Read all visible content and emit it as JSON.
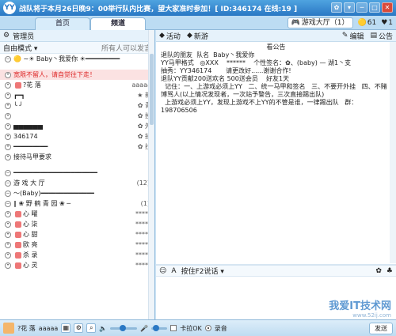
{
  "titlebar": {
    "title": "战队将于本月26日晚9：00举行队内比赛，望大家准时参加！[ ID:346174 在线:19 ]",
    "logo": "YY"
  },
  "tabs": [
    {
      "label": "首页",
      "active": false
    },
    {
      "label": "频道",
      "active": true
    }
  ],
  "status": {
    "hall_label": "游戏大厅（1）",
    "coins": "61",
    "hearts": "1"
  },
  "left": {
    "toolbar_label": "管理员",
    "mode_label": "自由模式",
    "mode_note": "所有人可以发言",
    "tree": [
      {
        "text": "🟡  ∼☀  Baby丶我爱你  ☀━━━━━━━━━",
        "type": "group"
      },
      {
        "text": "",
        "type": "sep"
      },
      {
        "text": "宽限不留人，请自觉往下走！",
        "type": "banner"
      },
      {
        "text": "?花  落",
        "stars": "aaaaa",
        "type": "user"
      },
      {
        "text": "┏━┓",
        "stars": "★  新",
        "type": "sub"
      },
      {
        "text": "╰ ╯",
        "stars": "✿  青",
        "type": "sub"
      },
      {
        "text": "",
        "stars": "✿  投",
        "type": "sub"
      },
      {
        "text": "▅▅▅▅▅▅",
        "stars": "✿  外",
        "type": "sub"
      },
      {
        "text": "346174",
        "stars": "✿  接",
        "type": "sub"
      },
      {
        "text": "━━━━━━━━━",
        "stars": "✿  找",
        "type": "sub"
      },
      {
        "text": "接待马甲要求",
        "type": "sub"
      },
      {
        "text": "",
        "type": "sep"
      },
      {
        "text": "━━━━━━━━━━━━━━━━━━━━━━",
        "type": "group"
      },
      {
        "text": "游 戏 大 厅",
        "count": "(12)",
        "type": "group"
      },
      {
        "text": "～(Baby)━━━━━━━━━━━━━━",
        "type": "group"
      },
      {
        "text": "∥ ❀ 野 鹤 青 园 ❀ ─",
        "count": "(1)",
        "type": "group"
      },
      {
        "text": "心  曜",
        "stars": "*****",
        "type": "user"
      },
      {
        "text": "心  柒",
        "stars": "*****",
        "type": "user"
      },
      {
        "text": "心  甜",
        "stars": "*****",
        "type": "user"
      },
      {
        "text": "欧  亮",
        "stars": "*****",
        "type": "user"
      },
      {
        "text": "杀  录",
        "stars": "*****",
        "type": "user"
      },
      {
        "text": "心  灵",
        "stars": "*****",
        "type": "user"
      }
    ]
  },
  "right": {
    "toolbar": {
      "activity": "活动",
      "new": "新游",
      "edit": "编辑",
      "notice": "公告"
    },
    "notice_title": "看公告",
    "notice_lines": [
      "退队的朋友  队名  Baby丶我爱你",
      "YY马甲格式   ◎XXX    ******    个性签名：✿、(baby) — 湖1丶支",
      "抽秀：YY346174       请更改好......谢谢合作!",
      "退队YY贡献200送欢名 500送会员    好友1天",
      "  记住：一、上游戏必须上YY   二、统一马甲和签名   三、不要开外挂   四、不赌",
      "博骂人(以上情况发现者，一次站予警告，三次直接踢出队)",
      "  上游戏必须上YY，发现上游戏不上YY的不管是谁，一律踢出队   群：198706506"
    ],
    "chat_bar": {
      "mode": "按住F2说话"
    }
  },
  "bottombar": {
    "username": "?花  落",
    "stars": "aaaaa",
    "mic_label": "卡拉OK",
    "record_label": "录音",
    "send_label": "发送"
  },
  "watermark": {
    "main": "我爱IT技术网",
    "sub": "www.52ij.com"
  }
}
